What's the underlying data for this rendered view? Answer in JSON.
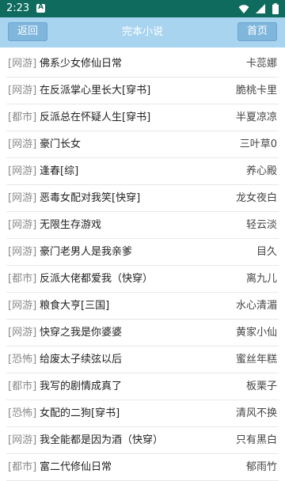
{
  "status": {
    "time": "2:23"
  },
  "header": {
    "back_label": "返回",
    "title": "完本小说",
    "home_label": "首页"
  },
  "books": [
    {
      "category": "[网游]",
      "title": "佛系少女修仙日常",
      "author": "卡蕊娜"
    },
    {
      "category": "[网游]",
      "title": "在反派掌心里长大[穿书]",
      "author": "脆桃卡里"
    },
    {
      "category": "[都市]",
      "title": "反派总在怀疑人生[穿书]",
      "author": "半夏凉凉"
    },
    {
      "category": "[网游]",
      "title": "豪门长女",
      "author": "三叶草0"
    },
    {
      "category": "[网游]",
      "title": "逢春[综]",
      "author": "养心殿"
    },
    {
      "category": "[网游]",
      "title": "恶毒女配对我笑[快穿]",
      "author": "龙女夜白"
    },
    {
      "category": "[网游]",
      "title": "无限生存游戏",
      "author": "轻云淡"
    },
    {
      "category": "[网游]",
      "title": "豪门老男人是我亲爹",
      "author": "目久"
    },
    {
      "category": "[都市]",
      "title": "反派大佬都爱我（快穿）",
      "author": "离九儿"
    },
    {
      "category": "[网游]",
      "title": "粮食大亨[三国]",
      "author": "水心清湄"
    },
    {
      "category": "[网游]",
      "title": "快穿之我是你婆婆",
      "author": "黄家小仙"
    },
    {
      "category": "[恐怖]",
      "title": "给废太子续弦以后",
      "author": "蜜丝年糕"
    },
    {
      "category": "[都市]",
      "title": "我写的剧情成真了",
      "author": "板栗子"
    },
    {
      "category": "[恐怖]",
      "title": "女配的二狗[穿书]",
      "author": "清风不换"
    },
    {
      "category": "[网游]",
      "title": "我全能都是因为酒（快穿）",
      "author": "只有黑白"
    },
    {
      "category": "[都市]",
      "title": "富二代修仙日常",
      "author": "郁雨竹"
    }
  ]
}
